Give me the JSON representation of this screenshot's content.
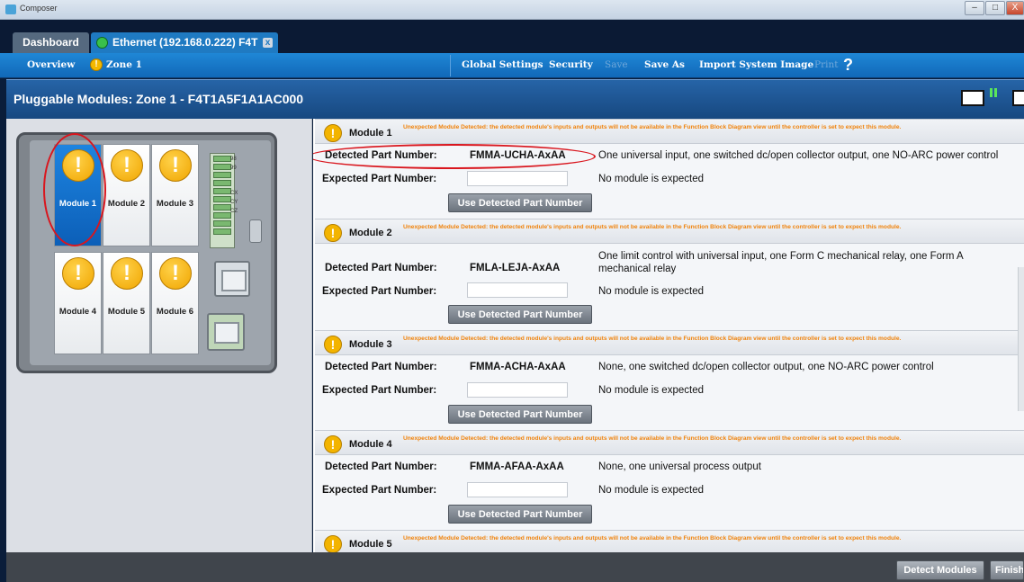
{
  "window": {
    "title": "Composer",
    "minimize": "–",
    "maximize": "□",
    "close": "X"
  },
  "tabs": [
    {
      "label": "Dashboard"
    },
    {
      "label": "Ethernet (192.168.0.222) F4T",
      "close": "x"
    }
  ],
  "nav": {
    "overview": "Overview",
    "zone": "Zone 1",
    "zone_icon": "!",
    "global_settings": "Global Settings",
    "security": "Security",
    "save": "Save",
    "save_as": "Save As",
    "import": "Import System Image",
    "print": "Print",
    "help": "?"
  },
  "header": {
    "title": "Pluggable Modules: Zone 1 - F4T1A5F1A1AC000"
  },
  "device": {
    "modules": [
      "Module 1",
      "Module 2",
      "Module 3",
      "Module 4",
      "Module 5",
      "Module 6"
    ],
    "selected": "Module 1",
    "warn_glyph": "!",
    "terminal_labels": [
      "98",
      "99",
      "CX",
      "CY",
      "CZ"
    ]
  },
  "labels": {
    "detected": "Detected Part Number:",
    "expected": "Expected Part Number:",
    "use_button": "Use Detected Part Number",
    "no_module": "No module is expected",
    "warning": "Unexpected Module Detected: the detected module's inputs and outputs will not be available in the Function Block Diagram view until the controller is set to expect this module."
  },
  "modules": [
    {
      "title": "Module 1",
      "detected": "FMMA-UCHA-AxAA",
      "description": "One universal input, one switched dc/open collector output, one NO-ARC power control",
      "expected": ""
    },
    {
      "title": "Module 2",
      "detected": "FMLA-LEJA-AxAA",
      "description": "One limit control with universal input, one Form C mechanical relay, one Form A mechanical relay",
      "expected": ""
    },
    {
      "title": "Module 3",
      "detected": "FMMA-ACHA-AxAA",
      "description": "None, one switched dc/open collector output, one NO-ARC power control",
      "expected": ""
    },
    {
      "title": "Module 4",
      "detected": "FMMA-AFAA-AxAA",
      "description": "None, one universal process output",
      "expected": ""
    },
    {
      "title": "Module 5"
    }
  ],
  "footer": {
    "detect": "Detect Modules",
    "finish": "Finish"
  },
  "colors": {
    "accent": "#1f7ac2",
    "warning_text": "#f0830c",
    "annotation": "#d9161e"
  }
}
